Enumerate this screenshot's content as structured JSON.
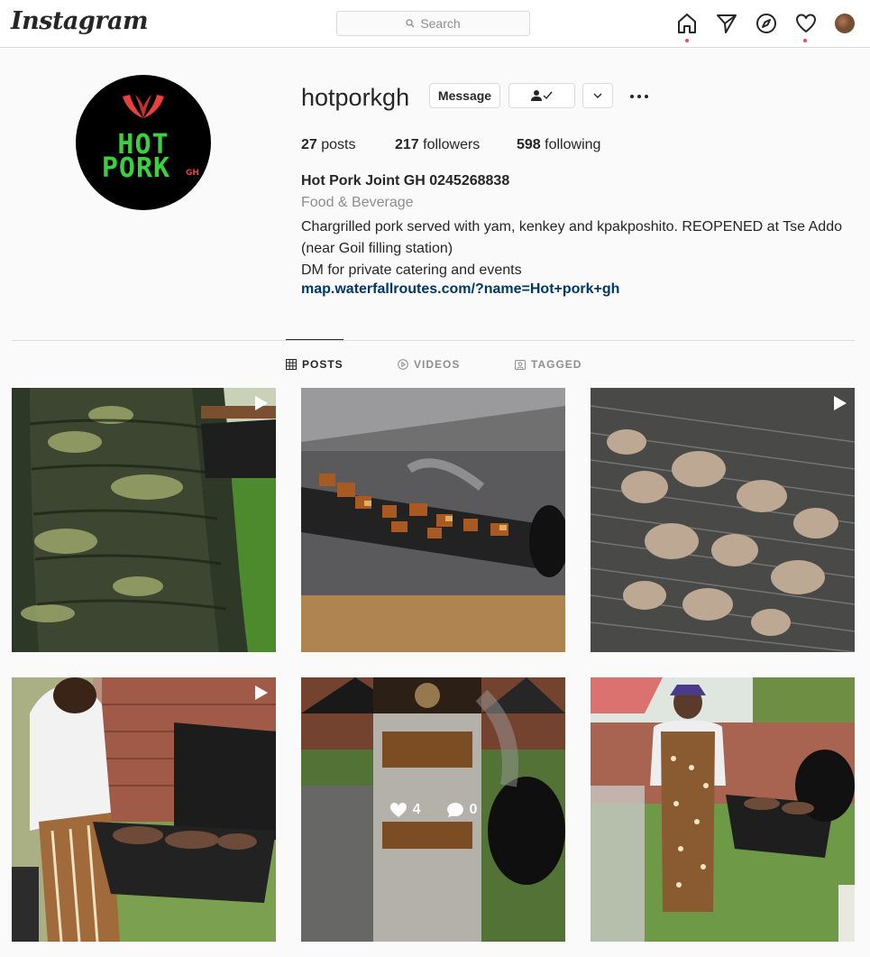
{
  "nav": {
    "logo": "Instagram",
    "search_placeholder": "Search",
    "icons": [
      "home-icon",
      "direct-icon",
      "explore-icon",
      "activity-icon",
      "profile-avatar"
    ]
  },
  "profile": {
    "username": "hotporkgh",
    "message_label": "Message",
    "pic_text_line1": "HOT",
    "pic_text_line2": "PORK",
    "pic_text_suffix": "GH",
    "stats": {
      "posts_count": "27",
      "posts_label": "posts",
      "followers_count": "217",
      "followers_label": "followers",
      "following_count": "598",
      "following_label": "following"
    },
    "full_name": "Hot Pork Joint GH 0245268838",
    "category": "Food & Beverage",
    "bio_line1": "Chargrilled pork served with yam, kenkey and kpakposhito. REOPENED at Tse Addo (near Goil filling station)",
    "bio_line2": "DM for private catering and events",
    "link": "map.waterfallroutes.com/?name=Hot+pork+gh"
  },
  "tabs": [
    {
      "label": "POSTS",
      "active": true
    },
    {
      "label": "VIDEOS",
      "active": false
    },
    {
      "label": "TAGGED",
      "active": false
    }
  ],
  "posts": [
    {
      "type": "video",
      "subject": "tree-trunk-and-grill"
    },
    {
      "type": "image",
      "subject": "meat-on-grill-roadside"
    },
    {
      "type": "video",
      "subject": "meat-on-grill-smoke"
    },
    {
      "type": "video",
      "subject": "man-grilling"
    },
    {
      "type": "image",
      "subject": "grill-and-banner",
      "likes": "4",
      "comments": "0",
      "hovered": true
    },
    {
      "type": "image",
      "subject": "man-in-apron-at-grill"
    }
  ],
  "colors": {
    "accent_link": "#00376b",
    "notification_dot": "#ed4956",
    "logo_green": "#3ad13f",
    "logo_red": "#e8403a"
  }
}
